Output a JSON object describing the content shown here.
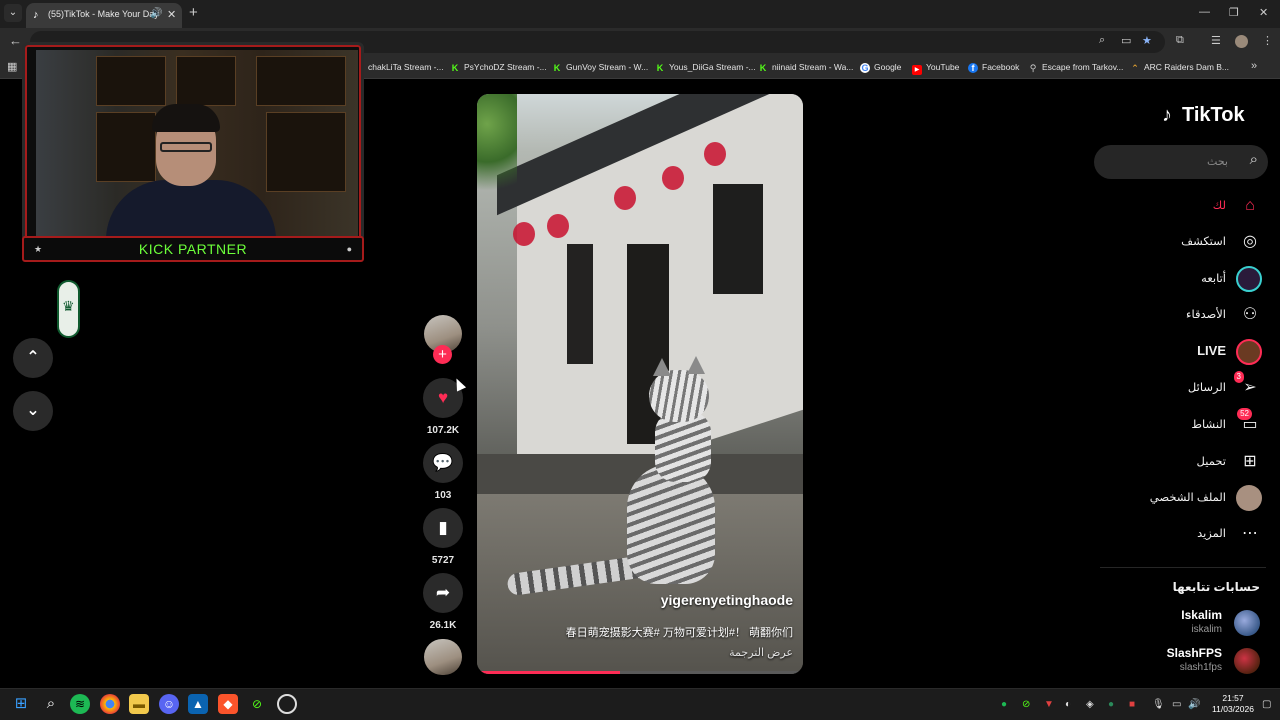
{
  "browser": {
    "tab_title": "(55)TikTok - Make Your Day",
    "bookmarks": [
      {
        "label": "chakLiTa Stream -...",
        "icon": "kick-icon"
      },
      {
        "label": "PsYchoDZ Stream -...",
        "icon": "kick-icon"
      },
      {
        "label": "GunVoy Stream - W...",
        "icon": "kick-icon"
      },
      {
        "label": "Yous_DiiGa Stream -...",
        "icon": "kick-icon"
      },
      {
        "label": "niinaid Stream - Wa...",
        "icon": "kick-icon"
      },
      {
        "label": "Google",
        "icon": "google-icon"
      },
      {
        "label": "YouTube",
        "icon": "youtube-icon"
      },
      {
        "label": "Facebook",
        "icon": "facebook-icon"
      },
      {
        "label": "Escape from Tarkov...",
        "icon": "tarkov-icon"
      },
      {
        "label": "ARC Raiders Dam B...",
        "icon": "arc-icon"
      }
    ]
  },
  "webcam": {
    "label": "KICK PARTNER"
  },
  "video": {
    "username": "yigerenyetinghaode",
    "caption": "春日萌宠摄影大赛# 万物可爱计划#！ 萌翻你们",
    "translate": "عرض الترجمة",
    "progress_fraction": 0.44
  },
  "actions": {
    "likes": "107.2K",
    "comments": "103",
    "saves": "5727",
    "shares": "26.1K"
  },
  "sidebar": {
    "brand": "TikTok",
    "search_placeholder": "بحث",
    "items": [
      {
        "label": "لك",
        "icon": "home-icon",
        "active": true
      },
      {
        "label": "استكشف",
        "icon": "compass-icon"
      },
      {
        "label": "أتابعه",
        "icon": "following-icon"
      },
      {
        "label": "الأصدقاء",
        "icon": "friends-icon"
      },
      {
        "label": "LIVE",
        "icon": "live-icon"
      },
      {
        "label": "الرسائل",
        "icon": "messages-icon",
        "badge": "3"
      },
      {
        "label": "النشاط",
        "icon": "activity-icon",
        "badge": "52"
      },
      {
        "label": "تحميل",
        "icon": "upload-icon"
      },
      {
        "label": "الملف الشخصي",
        "icon": "profile-icon"
      },
      {
        "label": "المزيد",
        "icon": "more-icon"
      }
    ],
    "following_title": "حسابات تتابعها",
    "following": [
      {
        "name": "Iskalim",
        "handle": "iskalim"
      },
      {
        "name": "SlashFPS",
        "handle": "slash1fps"
      }
    ]
  },
  "taskbar": {
    "time": "21:57",
    "date": "11/03/2026"
  },
  "colors": {
    "accent": "#fe2c55",
    "kick": "#53fc18"
  }
}
